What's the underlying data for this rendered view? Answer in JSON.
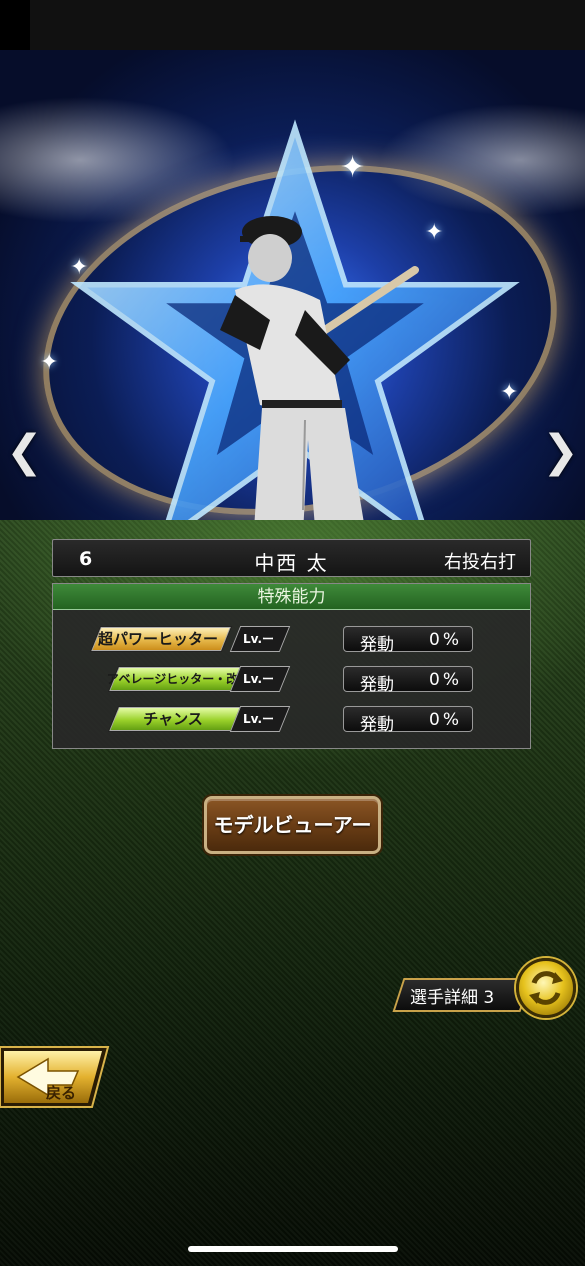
{
  "player": {
    "number": "6",
    "name": "中西 太",
    "handedness": "右投右打"
  },
  "abilities": {
    "header": "特殊能力",
    "items": [
      {
        "name": "超パワーヒッター",
        "level": "Lv.ー",
        "rate_label": "発動",
        "rate_value": "0%",
        "color": "gold"
      },
      {
        "name": "アベレージヒッター・改",
        "level": "Lv.ー",
        "rate_label": "発動",
        "rate_value": "0%",
        "color": "green"
      },
      {
        "name": "チャンス",
        "level": "Lv.ー",
        "rate_label": "発動",
        "rate_value": "0%",
        "color": "green"
      }
    ]
  },
  "buttons": {
    "model_viewer": "モデルビューアー",
    "player_detail": "選手詳細 3",
    "back": "戻る"
  },
  "nav": {
    "prev": "❮",
    "next": "❯"
  },
  "colors": {
    "abilities_header": "#2f7a2b",
    "gold_badge": "#e6b84a",
    "green_badge": "#9ad12a",
    "button_brown": "#6a3d15"
  }
}
